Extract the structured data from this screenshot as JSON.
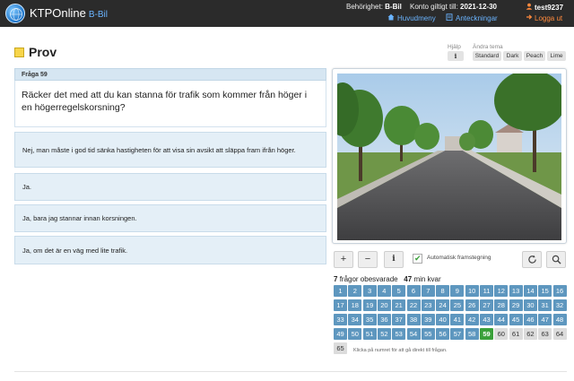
{
  "header": {
    "brand": "KTPOnline",
    "brand_sub": "B-Bil",
    "permission_label": "Behörighet:",
    "permission_value": "B-Bil",
    "valid_label": "Konto giltigt till:",
    "valid_value": "2021-12-30",
    "main_menu": "Huvudmeny",
    "notes": "Anteckningar",
    "user": "test9237",
    "logout": "Logga ut"
  },
  "page": {
    "title": "Prov",
    "help_label": "Hjälp",
    "help_icon": "i",
    "theme_label": "Ändra tema",
    "themes": [
      "Standard",
      "Dark",
      "Peach",
      "Lime"
    ]
  },
  "question": {
    "number_label": "Fråga 59",
    "text": "Räcker det med att du kan stanna för trafik som kommer från höger i en högerregelskorsning?",
    "answers": [
      "Nej, man måste i god tid sänka hastigheten för att visa sin avsikt att släppa fram ifrån höger.",
      "Ja.",
      "Ja, bara jag stannar innan korsningen.",
      "Ja, om det är en väg med lite trafik."
    ]
  },
  "controls": {
    "zoom_in": "+",
    "zoom_out": "−",
    "info": "i",
    "auto_advance_label": "Automatisk framstegning",
    "auto_advance_checked": true,
    "check_mark": "✔"
  },
  "stats": {
    "unanswered_count": "7",
    "unanswered_label": "frågor obesvarade",
    "minutes_left": "47",
    "minutes_label": "min kvar"
  },
  "grid": {
    "total": 65,
    "answered_until": 58,
    "current": 59,
    "hint": "Klicka på numret för att gå direkt till frågan."
  },
  "colors": {
    "answered": "#5e97bf",
    "current": "#3aa03a",
    "open": "#dcdcdc",
    "answer_bg": "#e4eff7",
    "topbar": "#2b2b2b",
    "link": "#6ab4ff",
    "logout": "#ff8a3d"
  }
}
